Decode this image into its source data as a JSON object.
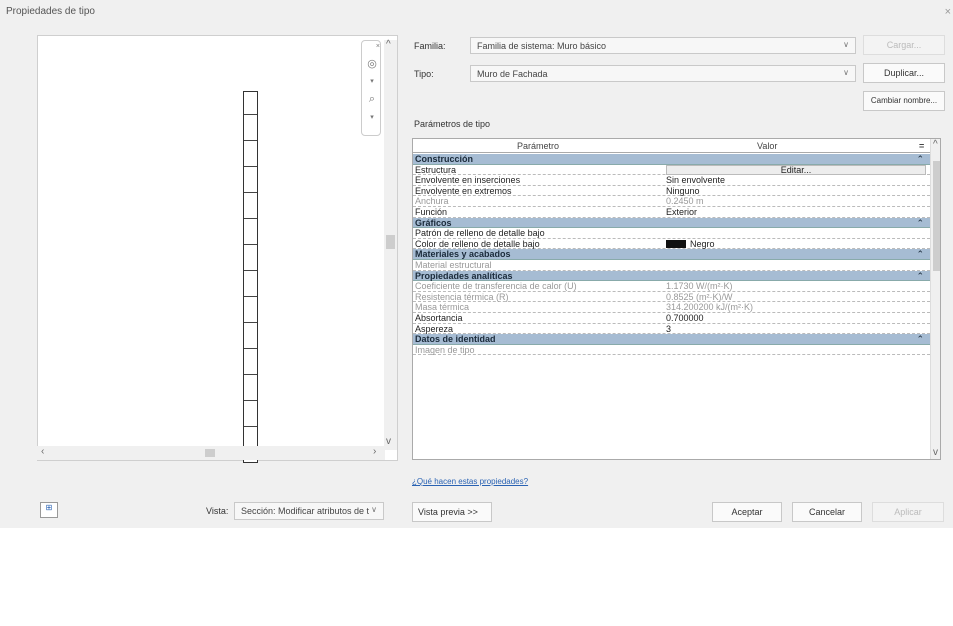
{
  "dialog": {
    "title": "Propiedades de tipo",
    "close": "×"
  },
  "preview": {
    "vista_label": "Vista:",
    "vista_value": "Sección: Modificar atributos de t",
    "preview_button": "Vista previa >>"
  },
  "fields": {
    "familia_label": "Familia:",
    "familia_value": "Familia de sistema: Muro básico",
    "tipo_label": "Tipo:",
    "tipo_value": "Muro de Fachada",
    "cargar": "Cargar...",
    "duplicar": "Duplicar...",
    "cambiar_nombre": "Cambiar nombre..."
  },
  "table": {
    "section_label": "Parámetros de tipo",
    "col_param": "Parámetro",
    "col_value": "Valor",
    "col_eq": "=",
    "edit_button": "Editar...",
    "rows": [
      {
        "kind": "group",
        "p": "Construcción",
        "v": ""
      },
      {
        "kind": "edit",
        "p": "Estructura",
        "v": ""
      },
      {
        "kind": "row",
        "p": "Envolvente en inserciones",
        "v": "Sin envolvente"
      },
      {
        "kind": "row",
        "p": "Envolvente en extremos",
        "v": "Ninguno"
      },
      {
        "kind": "dim",
        "p": "Anchura",
        "v": "0.2450 m"
      },
      {
        "kind": "row",
        "p": "Función",
        "v": "Exterior"
      },
      {
        "kind": "group",
        "p": "Gráficos",
        "v": ""
      },
      {
        "kind": "row",
        "p": "Patrón de relleno de detalle bajo",
        "v": ""
      },
      {
        "kind": "color",
        "p": "Color de relleno de detalle bajo",
        "v": "Negro"
      },
      {
        "kind": "group",
        "p": "Materiales y acabados",
        "v": ""
      },
      {
        "kind": "dim",
        "p": "Material estructural",
        "v": ""
      },
      {
        "kind": "group",
        "p": "Propiedades analíticas",
        "v": ""
      },
      {
        "kind": "dim",
        "p": "Coeficiente de transferencia de calor (U)",
        "v": "1.1730 W/(m²·K)"
      },
      {
        "kind": "dim",
        "p": "Resistencia térmica (R)",
        "v": "0.8525 (m²·K)/W"
      },
      {
        "kind": "dim",
        "p": "Masa térmica",
        "v": "314.200200 kJ/(m²·K)"
      },
      {
        "kind": "row",
        "p": "Absortancia",
        "v": "0.700000"
      },
      {
        "kind": "row",
        "p": "Aspereza",
        "v": "3"
      },
      {
        "kind": "group",
        "p": "Datos de identidad",
        "v": ""
      },
      {
        "kind": "dim",
        "p": "Imagen de tipo",
        "v": ""
      }
    ]
  },
  "help_link": "¿Qué hacen estas propiedades?",
  "buttons": {
    "aceptar": "Aceptar",
    "cancelar": "Cancelar",
    "aplicar": "Aplicar"
  }
}
